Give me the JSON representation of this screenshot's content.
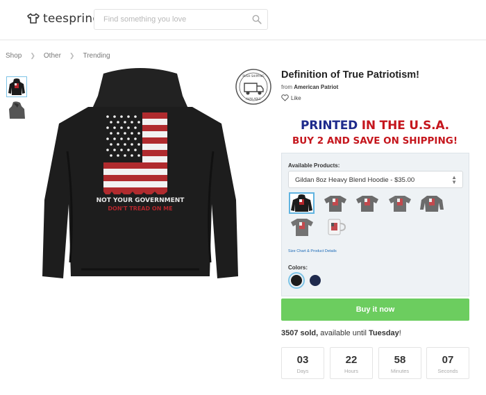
{
  "header": {
    "logo_text": "teespring",
    "search_placeholder": "Find something you love"
  },
  "breadcrumb": [
    "Shop",
    "Other",
    "Trending"
  ],
  "product": {
    "title": "Definition of True Patriotism!",
    "from_label": "from",
    "seller": "American Patriot",
    "like_label": "Like",
    "print_line1": "NOT YOUR GOVERNMENT",
    "print_line2": "DON'T TREAD ON ME",
    "badge_text": "RUSH SHIPPING AVAILABLE"
  },
  "promo": {
    "line1_part1": "PRINTED ",
    "line1_part2": "IN THE ",
    "line1_part3": "U.S.A.",
    "line2": "BUY 2 AND SAVE ON SHIPPING!",
    "colors": {
      "blue": "#1e2b8c",
      "red": "#c5161d"
    }
  },
  "selector": {
    "available_label": "Available Products:",
    "selected_product": "Gildan 8oz Heavy Blend Hoodie - $35.00",
    "size_chart_link": "Size Chart & Product Details",
    "colors_label": "Colors:",
    "swatches": [
      "#1c1c1c",
      "#1f2a4d"
    ]
  },
  "buy_button": {
    "label": "Buy it now",
    "color": "#6ccd5f"
  },
  "sales": {
    "count": "3507 sold,",
    "available_text": " available until ",
    "day": "Tuesday",
    "suffix": "!"
  },
  "countdown": [
    {
      "value": "03",
      "unit": "Days"
    },
    {
      "value": "22",
      "unit": "Hours"
    },
    {
      "value": "58",
      "unit": "Minutes"
    },
    {
      "value": "07",
      "unit": "Seconds"
    }
  ]
}
